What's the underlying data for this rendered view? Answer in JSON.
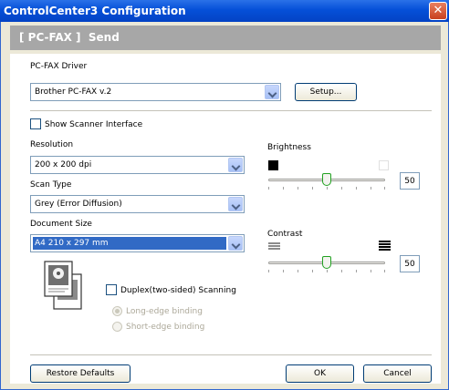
{
  "window": {
    "title": "ControlCenter3 Configuration"
  },
  "header": {
    "title": "[ PC-FAX ]  Send"
  },
  "driver": {
    "label": "PC-FAX Driver",
    "value": "Brother PC-FAX v.2",
    "setup_label": "Setup..."
  },
  "scanner": {
    "show_interface_label": "Show Scanner Interface",
    "checked": false
  },
  "resolution": {
    "label": "Resolution",
    "value": "200 x 200 dpi"
  },
  "scan_type": {
    "label": "Scan Type",
    "value": "Grey (Error Diffusion)"
  },
  "document_size": {
    "label": "Document Size",
    "value": "A4 210 x 297 mm"
  },
  "duplex": {
    "label": "Duplex(two-sided) Scanning",
    "checked": false,
    "options": [
      "Long-edge binding",
      "Short-edge binding"
    ],
    "selected": "Long-edge binding"
  },
  "brightness": {
    "label": "Brightness",
    "value": "50"
  },
  "contrast": {
    "label": "Contrast",
    "value": "50"
  },
  "buttons": {
    "restore": "Restore Defaults",
    "ok": "OK",
    "cancel": "Cancel"
  },
  "colors": {
    "titlebar": "#0550d8",
    "dialog_bg": "#ece9d8",
    "header_band": "#a7a7a7",
    "selection": "#316ac5"
  }
}
